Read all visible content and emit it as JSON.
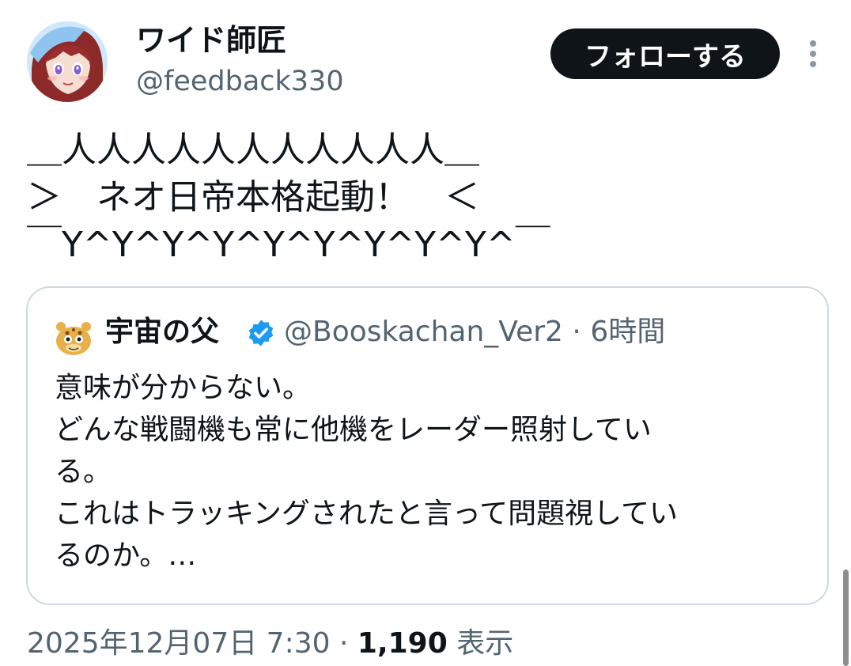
{
  "author": {
    "name": "ワイド師匠",
    "handle": "@feedback330",
    "avatar_icon": "anime-girl-avatar-icon"
  },
  "actions": {
    "follow_label": "フォローする",
    "more_icon": "more-vertical-icon"
  },
  "tweet": {
    "lines": [
      "＿人人人人人人人人人人人＿",
      "＞　ネオ日帝本格起動！　＜",
      "￣Y^Y^Y^Y^Y^Y^Y^Y^Y^￣"
    ]
  },
  "quote": {
    "author_name": "宇宙の父",
    "verified": true,
    "handle": "@Booskachan_Ver2",
    "separator": "·",
    "time": "6時間",
    "avatar_icon": "booska-character-avatar-icon",
    "lines": [
      "意味が分からない。",
      "どんな戦闘機も常に他機をレーダー照射してい",
      "る。",
      "これはトラッキングされたと言って問題視してい",
      "るのか。…"
    ]
  },
  "footer": {
    "timestamp": "2025年12月07日 7:30",
    "separator": "·",
    "views_count": "1,190",
    "views_label": "表示"
  },
  "colors": {
    "text_primary": "#0f1419",
    "text_secondary": "#536471",
    "border": "#cfd9de",
    "verified_blue": "#1d9bf0",
    "follow_bg": "#0f1419"
  }
}
